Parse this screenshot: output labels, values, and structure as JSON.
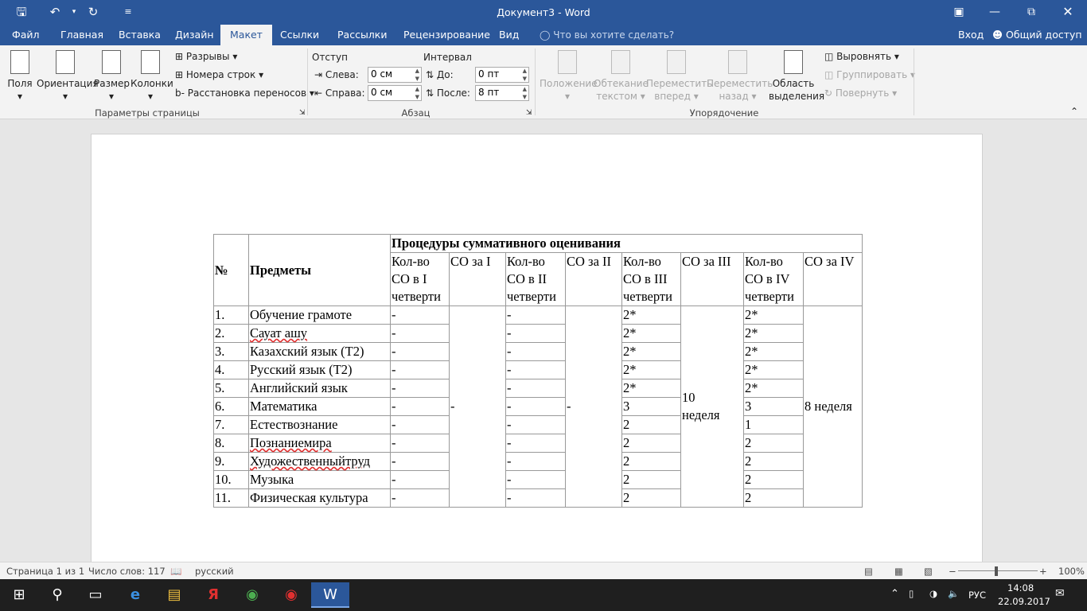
{
  "window": {
    "title": "Документ3 - Word"
  },
  "tabs": [
    "Файл",
    "Главная",
    "Вставка",
    "Дизайн",
    "Макет",
    "Ссылки",
    "Рассылки",
    "Рецензирование",
    "Вид"
  ],
  "tell_me": "Что вы хотите сделать?",
  "signin": "Вход",
  "share": "Общий доступ",
  "ribbon": {
    "page_setup": {
      "margins": "Поля",
      "orientation": "Ориентация",
      "size": "Размер",
      "columns": "Колонки",
      "breaks": "Разрывы",
      "line_numbers": "Номера строк",
      "hyphenation": "Расстановка переносов",
      "group_label": "Параметры страницы"
    },
    "paragraph": {
      "indent_label": "Отступ",
      "spacing_label": "Интервал",
      "left_label": "Слева:",
      "right_label": "Справа:",
      "before_label": "До:",
      "after_label": "После:",
      "left_value": "0 см",
      "right_value": "0 см",
      "before_value": "0 пт",
      "after_value": "8 пт",
      "group_label": "Абзац"
    },
    "arrange": {
      "position": "Положение",
      "wrap_1": "Обтекание",
      "wrap_2": "текстом",
      "forward_1": "Переместить",
      "forward_2": "вперед",
      "backward_1": "Переместить",
      "backward_2": "назад",
      "selection_1": "Область",
      "selection_2": "выделения",
      "align": "Выровнять",
      "group": "Группировать",
      "rotate": "Повернуть",
      "group_label": "Упорядочение"
    }
  },
  "table": {
    "h_num": "№",
    "h_subj": "Предметы",
    "h_proc": "Процедуры суммативного оценивания",
    "h_c1": [
      "Кол-во",
      "СО в I",
      "четверти"
    ],
    "h_s1": "СО за I",
    "h_c2": [
      "Кол-во",
      "СО в II",
      "четверти"
    ],
    "h_s2": "СО за II",
    "h_c3": [
      "Кол-во",
      "СО в III",
      "четверти"
    ],
    "h_s3": "СО за III",
    "h_c4": [
      "Кол-во",
      "СО в IV",
      "четверти"
    ],
    "h_s4": "СО за IV",
    "so1": "-",
    "so2": "-",
    "so3": [
      "10",
      "неделя"
    ],
    "so4": "8 неделя",
    "rows": [
      {
        "n": "1.",
        "s": "Обучение грамоте",
        "c1": "-",
        "c2": "-",
        "c3": "2*",
        "c4": "2*"
      },
      {
        "n": "2.",
        "s": "Сауат ашу",
        "c1": "-",
        "c2": "-",
        "c3": "2*",
        "c4": "2*"
      },
      {
        "n": "3.",
        "s": "Казахский язык (Т2)",
        "c1": "-",
        "c2": "-",
        "c3": "2*",
        "c4": "2*"
      },
      {
        "n": "4.",
        "s": "Русский язык (Т2)",
        "c1": "-",
        "c2": "-",
        "c3": "2*",
        "c4": "2*"
      },
      {
        "n": "5.",
        "s": "Английский язык",
        "c1": "-",
        "c2": "-",
        "c3": "2*",
        "c4": "2*"
      },
      {
        "n": "6.",
        "s": "Математика",
        "c1": "-",
        "c2": "-",
        "c3": "3",
        "c4": "3"
      },
      {
        "n": "7.",
        "s": "Естествознание",
        "c1": "-",
        "c2": "-",
        "c3": "2",
        "c4": "1"
      },
      {
        "n": "8.",
        "s": "Познаниемира",
        "c1": "-",
        "c2": "-",
        "c3": "2",
        "c4": "2"
      },
      {
        "n": "9.",
        "s": "Художественныйтруд",
        "c1": "-",
        "c2": "-",
        "c3": "2",
        "c4": "2"
      },
      {
        "n": "10.",
        "s": "Музыка",
        "c1": "-",
        "c2": "-",
        "c3": "2",
        "c4": "2"
      },
      {
        "n": "11.",
        "s": "Физическая культура",
        "c1": "-",
        "c2": "-",
        "c3": "2",
        "c4": "2"
      }
    ]
  },
  "status": {
    "page": "Страница 1 из 1",
    "words": "Число слов: 117",
    "lang": "русский",
    "zoom": "100%"
  },
  "tray": {
    "lang": "РУС",
    "time": "14:08",
    "date": "22.09.2017"
  }
}
